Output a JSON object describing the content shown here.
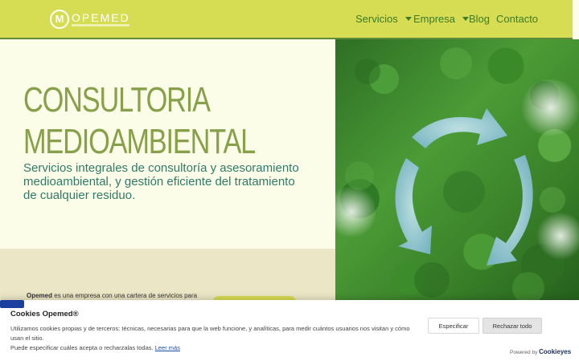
{
  "header": {
    "logo_mark": "M",
    "logo_word": "OPEMED",
    "nav": [
      {
        "label": "Servicios",
        "has_dropdown": true
      },
      {
        "label": "Empresa",
        "has_dropdown": true
      },
      {
        "label": "Blog",
        "has_dropdown": false
      },
      {
        "label": "Contacto",
        "has_dropdown": false
      }
    ]
  },
  "hero": {
    "title_line1": "CONSULTORIA",
    "title_line2": "MEDIOAMBIENTAL",
    "subtitle": "Servicios integrales de consultoría y asesoramiento medioambiental, y gestión eficiente del tratamiento de cualquier residuo."
  },
  "intro": {
    "brand": "Opemed",
    "text": " es una empresa con una cartera de servicios para"
  },
  "cookie": {
    "title": "Cookies Opemed®",
    "body_line1": "Utilizamos cookies propias y de terceros: técnicas, necesarias para que la web funcione, y analíticas, para medir cuántos usuarios nos visitan y cómo usan el sitio.",
    "body_line2": "Puede especificar cuáles acepta o recharzalas todas.",
    "read_more": "Leer más",
    "customize_label": "Especificar",
    "reject_label": "Rechazar todo",
    "powered_by": "Powered by",
    "powered_brand": "Cookieyes"
  },
  "colors": {
    "header_bg": "#d6dd52",
    "accent_green": "#3a7c2a",
    "title_olive": "#87a04a",
    "subtitle_teal": "#2f7a6a",
    "accept_blue": "#1a3f9f"
  }
}
